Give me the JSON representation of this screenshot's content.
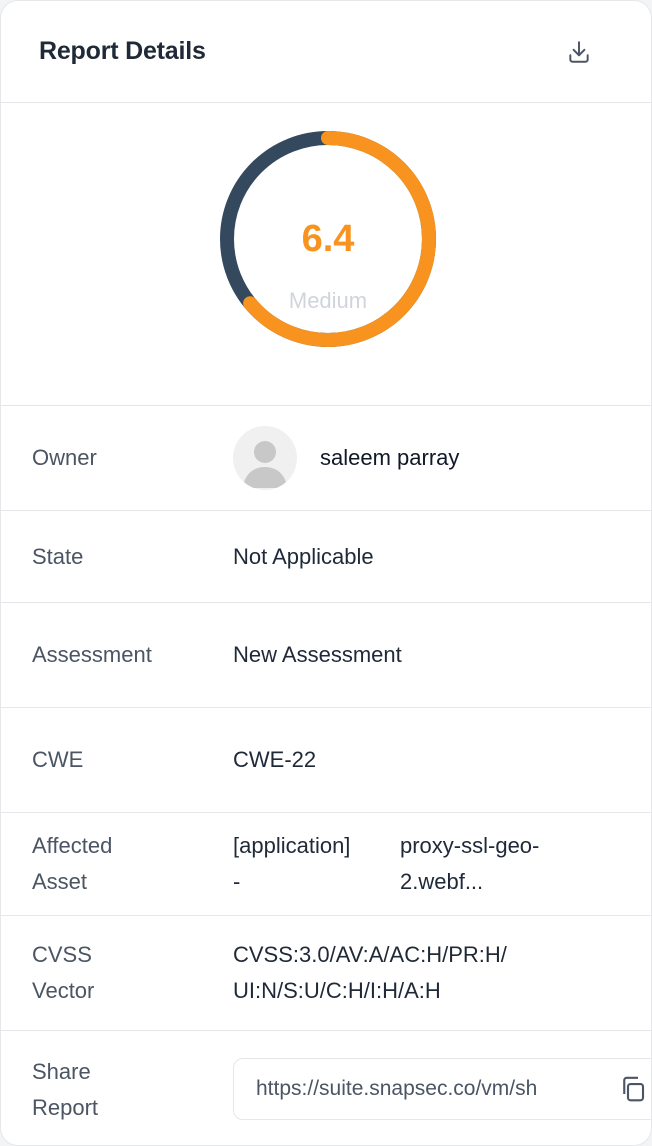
{
  "header": {
    "title": "Report Details",
    "download_icon": "download-icon"
  },
  "score": {
    "value": "6.4",
    "severity": "Medium",
    "fraction": 0.64,
    "colors": {
      "score": "#f7931e",
      "track": "#34495e"
    }
  },
  "details": {
    "owner": {
      "label": "Owner",
      "name": "saleem parray",
      "avatar_icon": "user-avatar-icon"
    },
    "state": {
      "label": "State",
      "value": "Not Applicable"
    },
    "assessment": {
      "label": "Assessment",
      "value": "New Assessment"
    },
    "cwe": {
      "label": "CWE",
      "value": "CWE-22"
    },
    "affected_asset": {
      "label_line1": "Affected",
      "label_line2": "Asset",
      "type_line1": "[application]",
      "type_line2": "-",
      "name_line1": "proxy-ssl-geo-",
      "name_line2": "2.webf..."
    },
    "cvss_vector": {
      "label_line1": "CVSS",
      "label_line2": "Vector",
      "value_line1": "CVSS:3.0/AV:A/AC:H/PR:H/",
      "value_line2": "UI:N/S:U/C:H/I:H/A:H"
    },
    "share_report": {
      "label_line1": "Share",
      "label_line2": "Report",
      "url": "https://suite.snapsec.co/vm/sh",
      "copy_icon": "copy-icon"
    }
  }
}
